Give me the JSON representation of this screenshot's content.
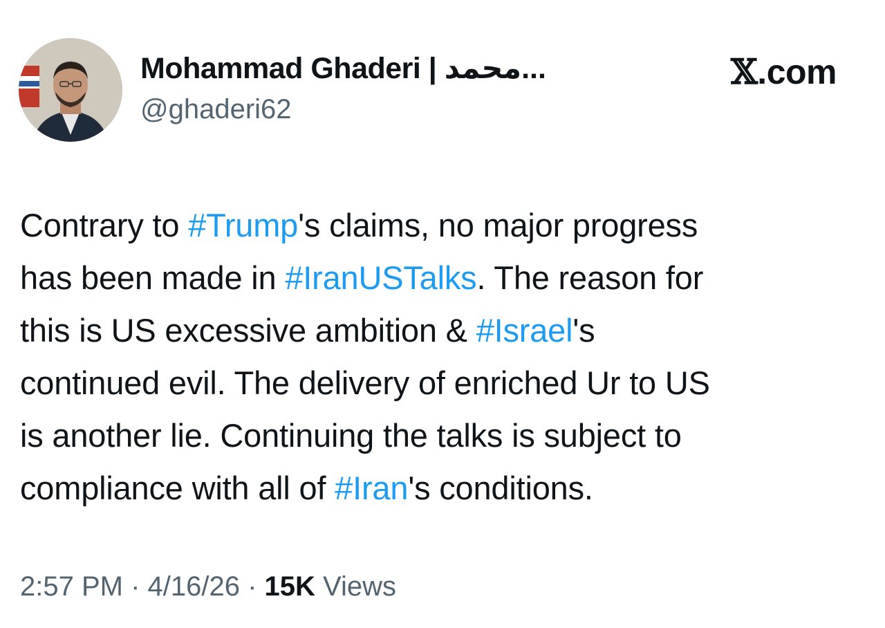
{
  "author": {
    "display_name": "Mohammad Ghaderi | محمد...",
    "handle": "@ghaderi62",
    "avatar_icon": "profile-photo"
  },
  "site": {
    "logo_text": ".com",
    "logo_glyph": "𝕏"
  },
  "tweet": {
    "lines": [
      [
        {
          "t": "Contrary to "
        },
        {
          "t": "#Trump",
          "h": true
        },
        {
          "t": "'s claims, no major progress"
        }
      ],
      [
        {
          "t": "has been made in "
        },
        {
          "t": "#IranUSTalks",
          "h": true
        },
        {
          "t": ". The reason for"
        }
      ],
      [
        {
          "t": "this is US excessive ambition & "
        },
        {
          "t": "#Israel",
          "h": true
        },
        {
          "t": "'s"
        }
      ],
      [
        {
          "t": "continued evil. The delivery of enriched Ur to US"
        }
      ],
      [
        {
          "t": "is another lie. Continuing the talks is subject to"
        }
      ],
      [
        {
          "t": "compliance with all of "
        },
        {
          "t": "#Iran",
          "h": true
        },
        {
          "t": "'s conditions."
        }
      ]
    ],
    "hashtag_color": "#1d9bf0"
  },
  "meta": {
    "time": "2:57 PM",
    "separator": " · ",
    "date": "4/16/26",
    "views_count": "15K",
    "views_label": " Views"
  }
}
